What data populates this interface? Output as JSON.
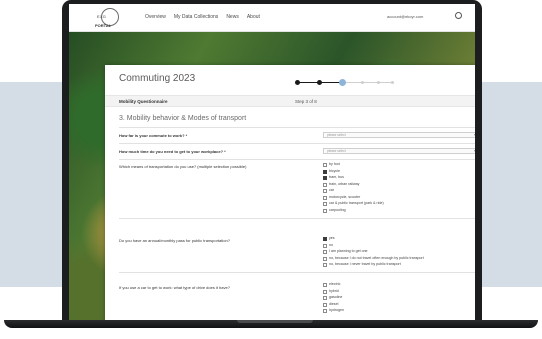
{
  "header": {
    "logo_top": "EXG",
    "logo_bottom": "PORTAL",
    "nav": [
      "Overview",
      "My Data Collections",
      "News",
      "About"
    ],
    "account": "account@ekoyr.com"
  },
  "modal": {
    "title": "Commuting 2023",
    "close_label": "×",
    "progress": {
      "current_step": 3,
      "total_steps": 8
    },
    "subhead_left": "Mobility Questionnaire",
    "subhead_step": "Step 3 of 8",
    "section_title": "3. Mobility behavior & Modes of transport"
  },
  "questions": {
    "q1": {
      "label": "How far is your commute to work? *",
      "placeholder": "please select"
    },
    "q2": {
      "label": "How much time do you need to get to your workplace? *",
      "placeholder": "please select"
    },
    "q3": {
      "label": "Which means of transportation do you use? (multiple selection possible)",
      "options": [
        {
          "label": "by foot",
          "checked": false
        },
        {
          "label": "bicycle",
          "checked": true
        },
        {
          "label": "tram, bus",
          "checked": true
        },
        {
          "label": "train, urban railway",
          "checked": false
        },
        {
          "label": "car",
          "checked": false
        },
        {
          "label": "motorcycle, scooter",
          "checked": false
        },
        {
          "label": "car & public transport (park & ride)",
          "checked": false
        },
        {
          "label": "carpooling",
          "checked": false
        }
      ]
    },
    "q4": {
      "label": "Do you have an annual/monthly pass for public transportation?",
      "options": [
        {
          "label": "yes",
          "checked": true
        },
        {
          "label": "no",
          "checked": false
        },
        {
          "label": "I am planning to get one",
          "checked": false
        },
        {
          "label": "no, because I do not travel often enough by public transport",
          "checked": false
        },
        {
          "label": "no, because I never travel by public transport",
          "checked": false
        }
      ]
    },
    "q5": {
      "label": "If you use a car to get to work: what type of drive does it have?",
      "options": [
        {
          "label": "electric",
          "checked": false
        },
        {
          "label": "hybrid",
          "checked": false
        },
        {
          "label": "gasoline",
          "checked": false
        },
        {
          "label": "diesel",
          "checked": false
        },
        {
          "label": "hydrogen",
          "checked": false
        }
      ]
    }
  },
  "colors": {
    "stepper_active": "#1a1a1a",
    "stepper_current": "#8fb4d9",
    "stepper_inactive": "#cfcfcf",
    "band": "#d4dce6"
  }
}
